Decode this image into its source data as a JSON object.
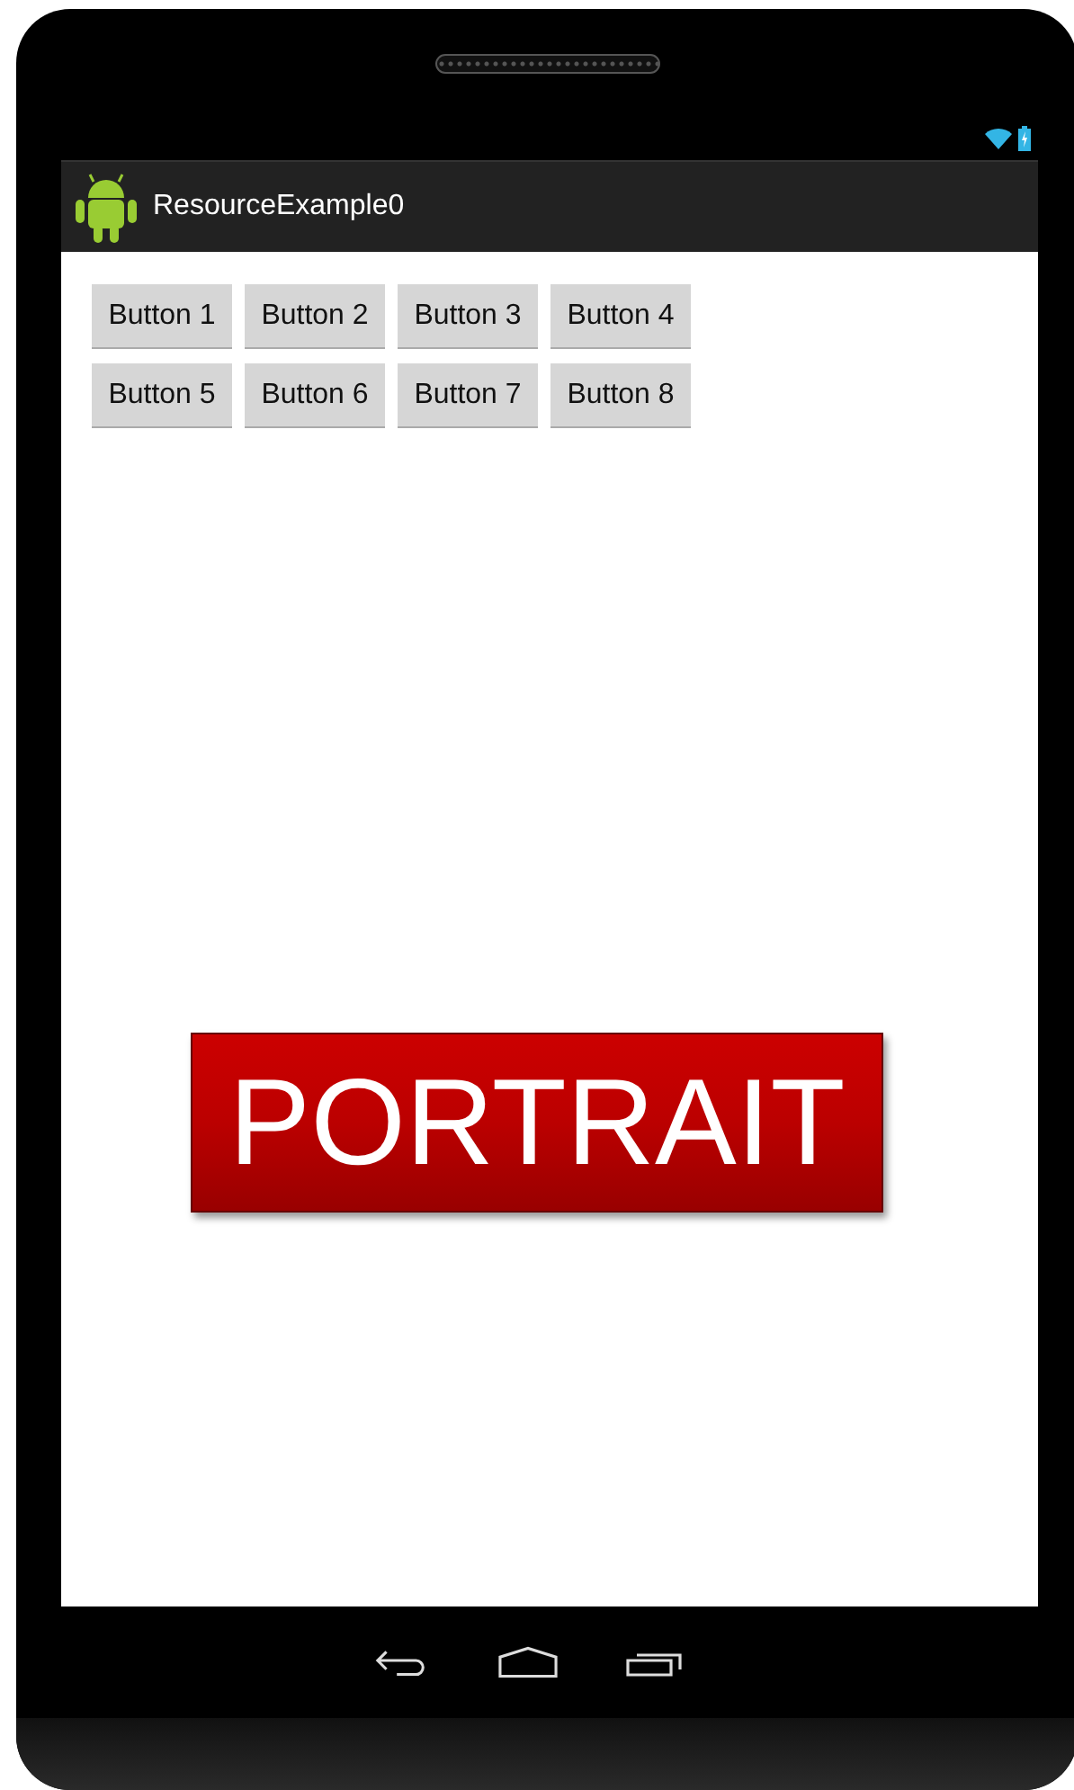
{
  "action_bar": {
    "title": "ResourceExample0"
  },
  "button_rows": [
    [
      "Button 1",
      "Button 2",
      "Button 3",
      "Button 4"
    ],
    [
      "Button 5",
      "Button 6",
      "Button 7",
      "Button 8"
    ]
  ],
  "big_button": {
    "label": "PORTRAIT"
  }
}
